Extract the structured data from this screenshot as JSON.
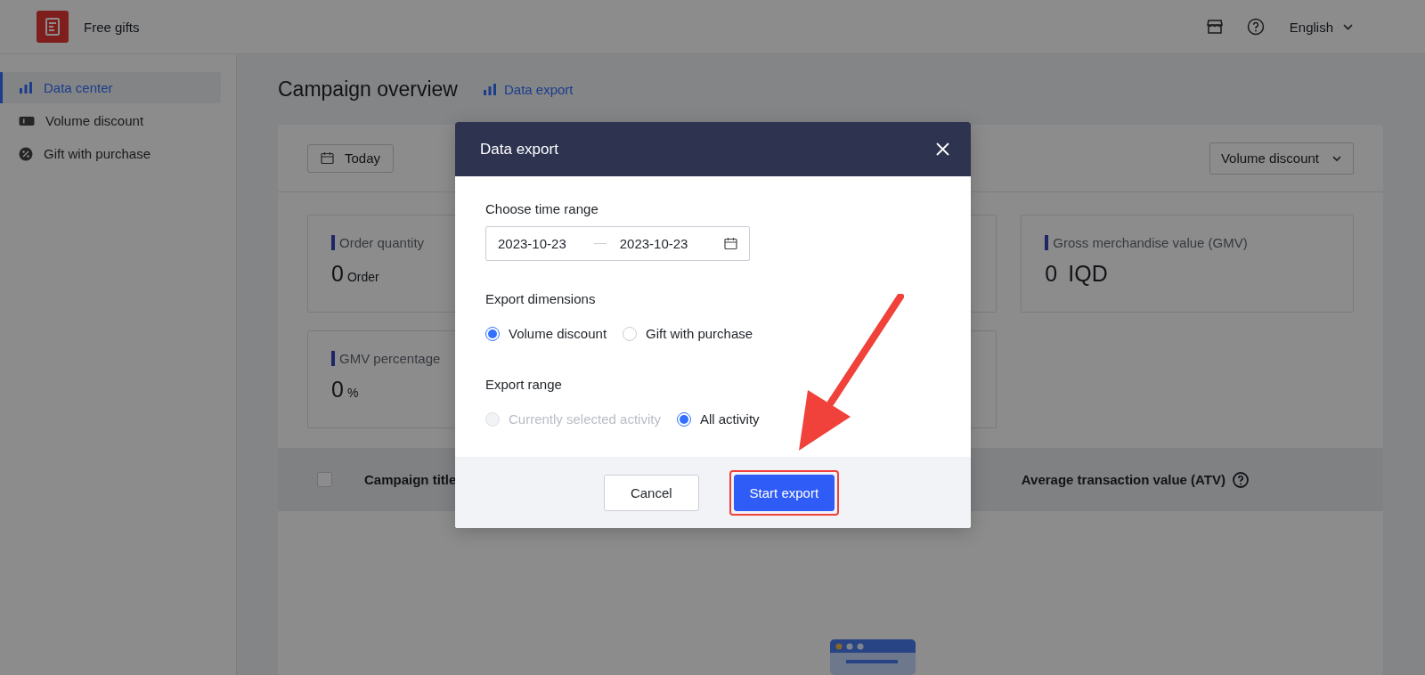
{
  "app": {
    "title": "Free gifts"
  },
  "header": {
    "language": "English"
  },
  "sidebar": {
    "items": [
      {
        "label": "Data center",
        "selected": true
      },
      {
        "label": "Volume discount",
        "selected": false
      },
      {
        "label": "Gift with purchase",
        "selected": false
      }
    ]
  },
  "page": {
    "title": "Campaign overview",
    "export_link": "Data export"
  },
  "filters": {
    "date_button": "Today",
    "campaign_select": "Volume discount"
  },
  "metrics": [
    {
      "label": "Order quantity",
      "value": "0",
      "unit": "Order",
      "kind": "small-unit"
    },
    {
      "label": "Gross merchandise value (GMV)",
      "value": "0",
      "unit": "IQD",
      "kind": "large-unit"
    },
    {
      "label": "GMV percentage",
      "value": "0",
      "unit": "%",
      "kind": "small-unit"
    }
  ],
  "table": {
    "columns": [
      "Campaign title",
      "Average transaction value (ATV)"
    ],
    "select_all_checked": false
  },
  "dialog": {
    "title": "Data export",
    "time_range": {
      "label": "Choose time range",
      "start": "2023-10-23",
      "end": "2023-10-23"
    },
    "dimensions": {
      "label": "Export dimensions",
      "options": [
        {
          "label": "Volume discount",
          "selected": true,
          "disabled": false
        },
        {
          "label": "Gift with purchase",
          "selected": false,
          "disabled": false
        }
      ]
    },
    "range": {
      "label": "Export range",
      "options": [
        {
          "label": "Currently selected activity",
          "selected": false,
          "disabled": true
        },
        {
          "label": "All activity",
          "selected": true,
          "disabled": false
        }
      ]
    },
    "buttons": [
      {
        "label": "Cancel",
        "kind": "secondary",
        "highlighted": false
      },
      {
        "label": "Start export",
        "kind": "primary",
        "highlighted": true
      }
    ]
  }
}
